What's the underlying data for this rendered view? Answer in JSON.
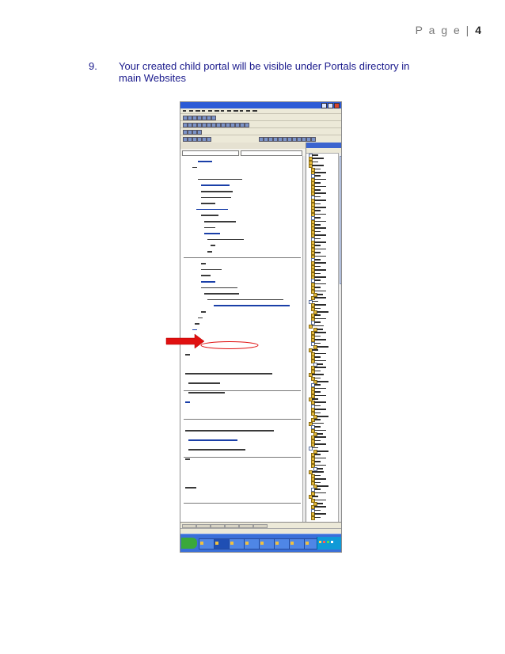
{
  "header": {
    "prefix": "P a g e  |",
    "number": "4"
  },
  "step": {
    "number": "9.",
    "text": "Your created child portal will be visible under Portals directory in main Websites"
  },
  "screenshot": {
    "colors": {
      "titlebar": "#2c5bd6",
      "editor_bg": "#ffffff",
      "taskbar": "#3a6fd8",
      "arrow": "#e01010",
      "highlight": "#e01010",
      "folder": "#e2b83b"
    },
    "icons": [
      "close-icon",
      "maximize-icon",
      "minimize-icon",
      "folder-icon",
      "file-icon",
      "red-arrow-icon",
      "start-icon"
    ]
  }
}
